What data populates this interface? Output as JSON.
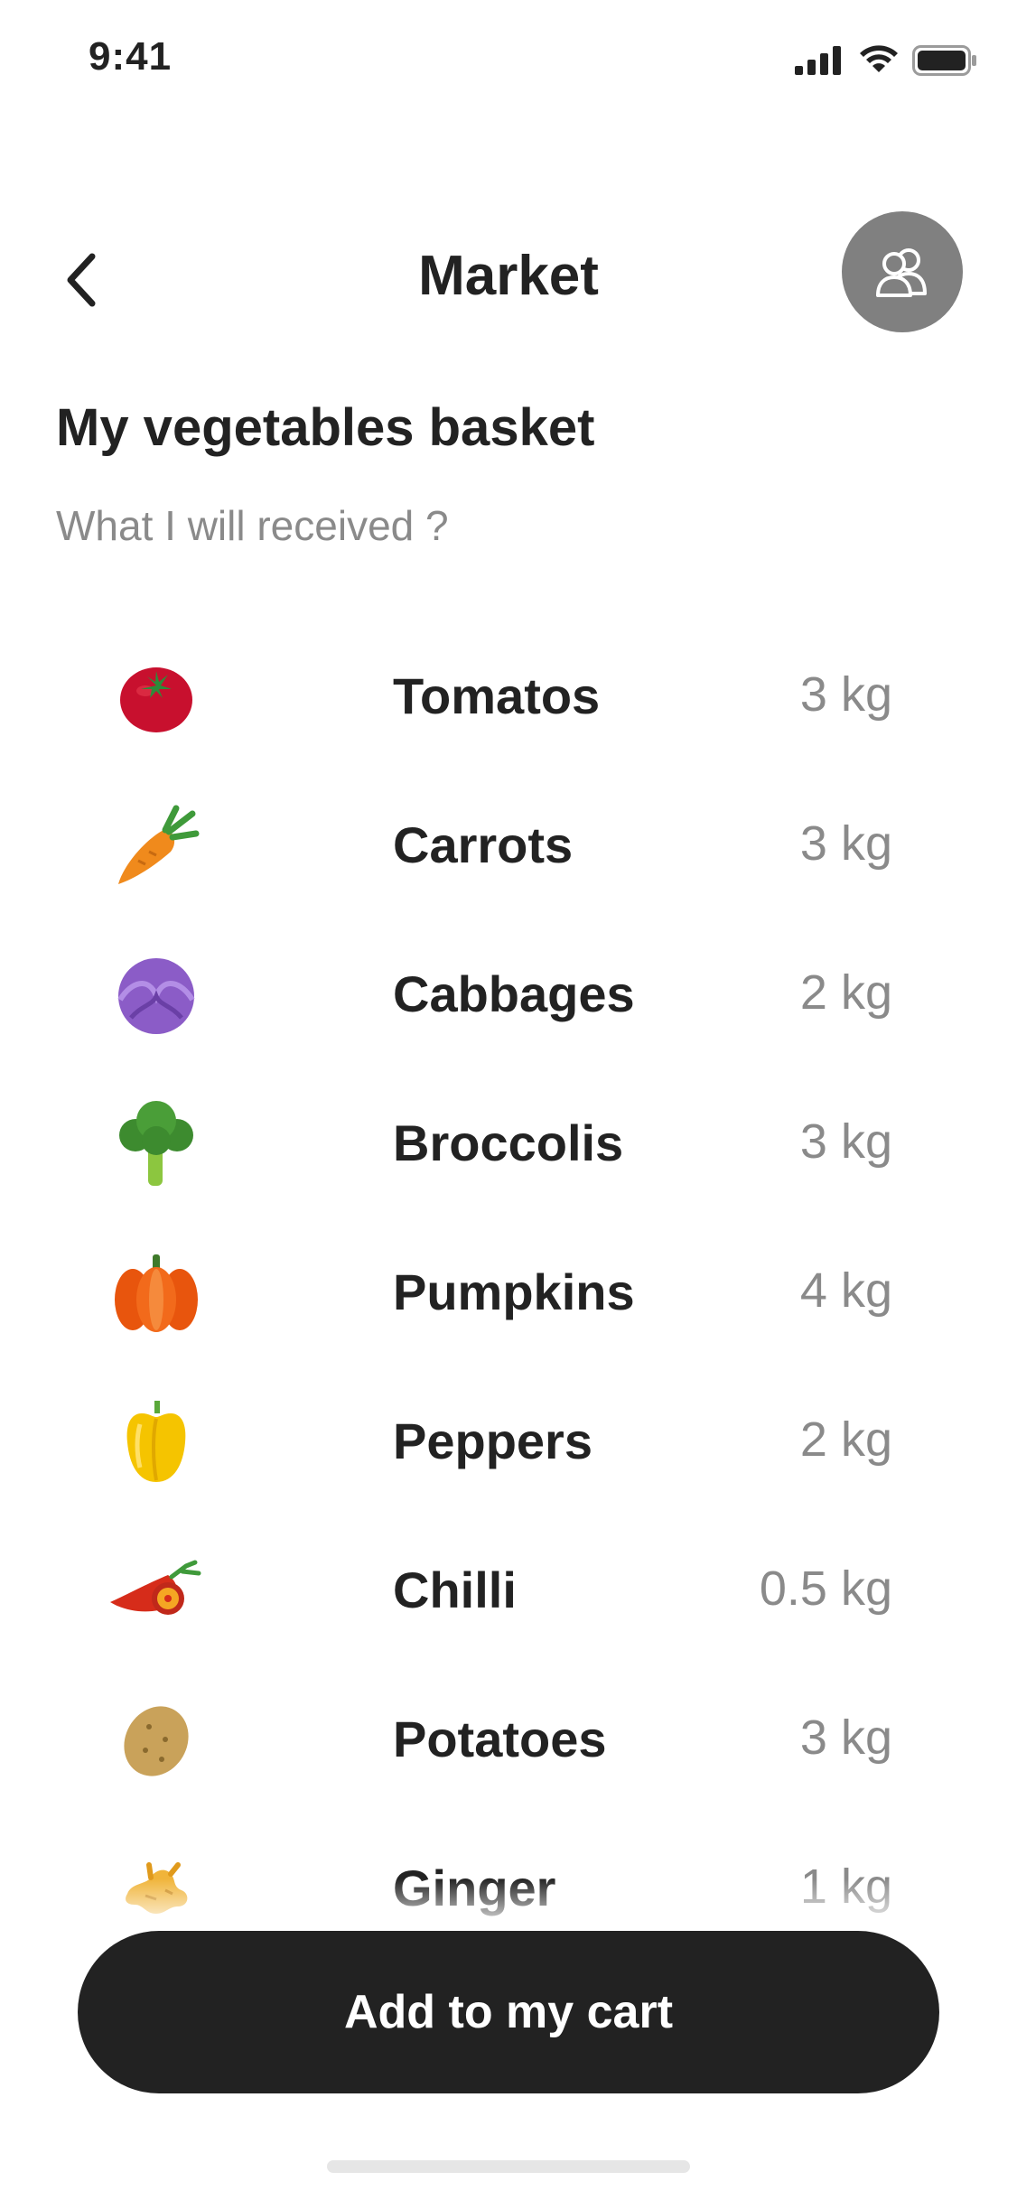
{
  "status": {
    "time": "9:41"
  },
  "nav": {
    "title": "Market"
  },
  "basket": {
    "title": "My vegetables basket",
    "subtitle": "What I will received ?"
  },
  "items": [
    {
      "name": "Tomatos",
      "qty": "3 kg",
      "icon": "tomato-icon"
    },
    {
      "name": "Carrots",
      "qty": "3 kg",
      "icon": "carrot-icon"
    },
    {
      "name": "Cabbages",
      "qty": "2 kg",
      "icon": "cabbage-icon"
    },
    {
      "name": "Broccolis",
      "qty": "3 kg",
      "icon": "broccoli-icon"
    },
    {
      "name": "Pumpkins",
      "qty": "4 kg",
      "icon": "pumpkin-icon"
    },
    {
      "name": "Peppers",
      "qty": "2 kg",
      "icon": "pepper-icon"
    },
    {
      "name": "Chilli",
      "qty": "0.5 kg",
      "icon": "chilli-icon"
    },
    {
      "name": "Potatoes",
      "qty": "3 kg",
      "icon": "potato-icon"
    },
    {
      "name": "Ginger",
      "qty": "1 kg",
      "icon": "ginger-icon"
    }
  ],
  "cart_button": {
    "label": "Add to my cart"
  },
  "colors": {
    "primary_dark": "#222222",
    "secondary_text": "#8a8a8a",
    "people_button_bg": "#808080",
    "background": "#ffffff"
  }
}
